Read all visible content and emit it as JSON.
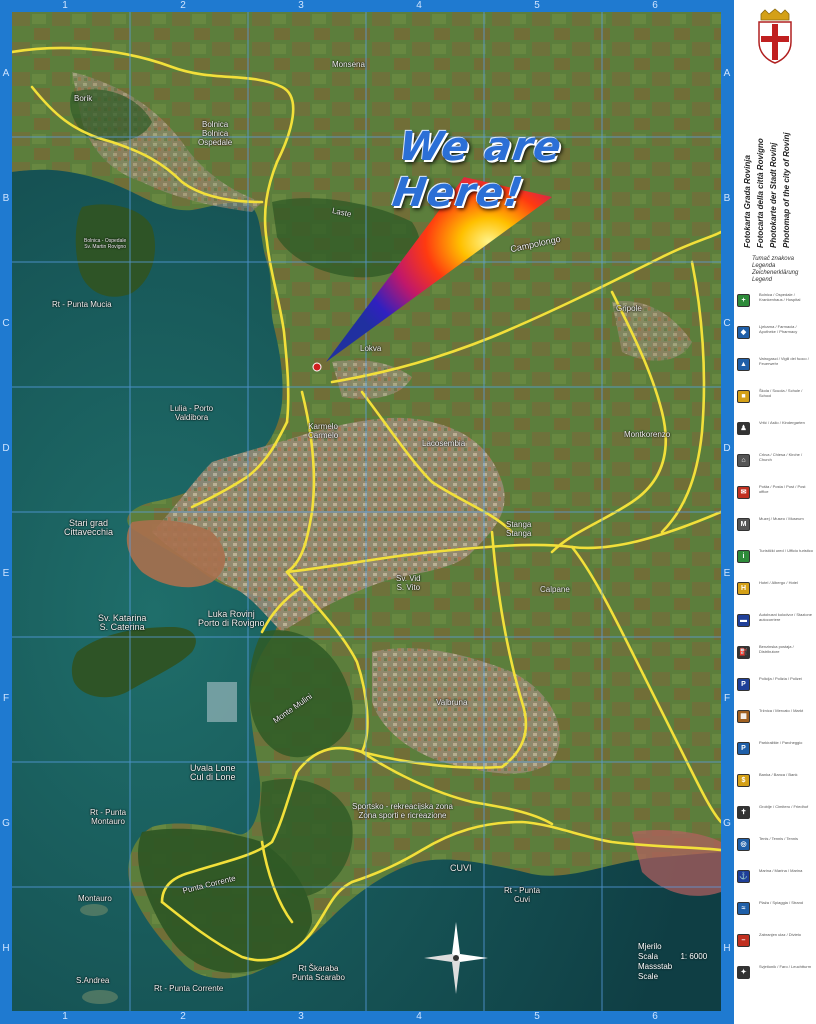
{
  "headline": "We are Here!",
  "grid": {
    "columns": [
      "1",
      "2",
      "3",
      "4",
      "5",
      "6"
    ],
    "rows": [
      "A",
      "B",
      "C",
      "D",
      "E",
      "F",
      "G",
      "H"
    ]
  },
  "places": {
    "borik": "Borik",
    "bolnica": "Bolnica\nBolnica\nOspedale",
    "monsena": "Monsena",
    "laste": "Laste",
    "campolongo": "Campolongo",
    "gripole": "Gripole",
    "bolnica_rovigno": "Bolnica - Ospedale\nSv. Martin Rovigno",
    "rt_punta_mucia": "Rt - Punta Mucia",
    "lokva": "Lokva",
    "lulia": "Lulia - Porto\nValdibora",
    "karmelo": "Karmelo\nCarmelo",
    "lacosembia": "Lacosembia",
    "montkorenzo": "Montkorenzo",
    "stari_grad": "Stari grad\nCittavecchia",
    "stanga": "Stanga\nStanga",
    "sv_vid": "Sv. Vid\nS. Vito",
    "calpane": "Calpane",
    "luka": "Luka Rovinj\nPorto di Rovigno",
    "katarina": "Sv. Katarina\nS. Caterina",
    "monte_mulini": "Monte Mulini",
    "valbruna": "Valbruna",
    "uvala_lone": "Uvala Lone\nCul di Lone",
    "rt_punta_montauro": "Rt - Punta\nMontauro",
    "sportska": "Sportsko - rekreacijska zona\nZona sporti e ricreazione",
    "punta_corrente": "Punta Corrente",
    "montauro": "Montauro",
    "rt_punta_cuvi": "Rt - Punta\nCuvi",
    "cuvi": "CUVI",
    "rt_skaraba": "Rt Škaraba\nPunta Scarabo",
    "rt_punta_corrente": "Rt - Punta Corrente",
    "sampieri": "S.Andrea"
  },
  "scale_text": "Mjerilo\nScala\nMassstab\nScale",
  "scale_value": "1: 6000",
  "titles": [
    "Fotokarta Grada Rovinja",
    "Fotocarta della città Rovigno",
    "Photokarte der Stadt Rovinj",
    "Photomap of the city of Rovinj"
  ],
  "legend_head": "Tumač znakova\nLegenda\nZeichenerklärung\nLegend",
  "legend_items": [
    {
      "icon": "hospital-icon",
      "color": "#2e8b3a",
      "glyph": "+",
      "text": "Bolnica / Ospedale / Krankenhaus / Hospital"
    },
    {
      "icon": "pharmacy-icon",
      "color": "#1f5fa8",
      "glyph": "◆",
      "text": "Ljekarna / Farmacia / Apotheke / Pharmacy"
    },
    {
      "icon": "fire-station-icon",
      "color": "#1f5fa8",
      "glyph": "▲",
      "text": "Vatrogasci / Vigili del fuoco / Feuerwehr"
    },
    {
      "icon": "school-icon",
      "color": "#d4a017",
      "glyph": "■",
      "text": "Škola / Scuola / Schule / School"
    },
    {
      "icon": "kindergarten-icon",
      "color": "#333333",
      "glyph": "♟",
      "text": "Vrtić / Asilo / Kindergarten"
    },
    {
      "icon": "church-icon",
      "color": "#555555",
      "glyph": "⌂",
      "text": "Crkva / Chiesa / Kirche / Church"
    },
    {
      "icon": "post-office-icon",
      "color": "#c03020",
      "glyph": "✉",
      "text": "Pošta / Posta / Post / Post office"
    },
    {
      "icon": "museum-icon",
      "color": "#555555",
      "glyph": "M",
      "text": "Muzej / Museo / Museum"
    },
    {
      "icon": "tourist-info-icon",
      "color": "#2e8b3a",
      "glyph": "i",
      "text": "Turistički ured / Ufficio turistico"
    },
    {
      "icon": "hotel-icon",
      "color": "#d4a017",
      "glyph": "H",
      "text": "Hotel / Albergo / Hotel"
    },
    {
      "icon": "bus-station-icon",
      "color": "#1f3f98",
      "glyph": "▬",
      "text": "Autobusni kolodvor / Stazione autocorriere"
    },
    {
      "icon": "gas-station-icon",
      "color": "#333333",
      "glyph": "⛽",
      "text": "Benzinska postaja / Distributore"
    },
    {
      "icon": "police-icon",
      "color": "#1f3f98",
      "glyph": "P",
      "text": "Policija / Polizia / Polizei"
    },
    {
      "icon": "market-icon",
      "color": "#a06020",
      "glyph": "▦",
      "text": "Tržnica / Mercato / Markt"
    },
    {
      "icon": "parking-icon",
      "color": "#1f5fa8",
      "glyph": "P",
      "text": "Parkiralište / Parcheggio"
    },
    {
      "icon": "bank-icon",
      "color": "#d4a017",
      "glyph": "$",
      "text": "Banka / Banca / Bank"
    },
    {
      "icon": "cemetery-icon",
      "color": "#333333",
      "glyph": "✝",
      "text": "Groblje / Cimitero / Friedhof"
    },
    {
      "icon": "tennis-icon",
      "color": "#1f5fa8",
      "glyph": "◎",
      "text": "Tenis / Tennis / Tennis"
    },
    {
      "icon": "anchor-icon",
      "color": "#1f3f98",
      "glyph": "⚓",
      "text": "Marina / Marina / Marina"
    },
    {
      "icon": "beach-icon",
      "color": "#1f5fa8",
      "glyph": "≈",
      "text": "Plaža / Spiaggia / Strand"
    },
    {
      "icon": "no-entry-icon",
      "color": "#c03020",
      "glyph": "–",
      "text": "Zabranjen ulaz / Divieto"
    },
    {
      "icon": "lighthouse-icon",
      "color": "#333333",
      "glyph": "✦",
      "text": "Svjetionik / Faro / Leuchtturm"
    }
  ]
}
